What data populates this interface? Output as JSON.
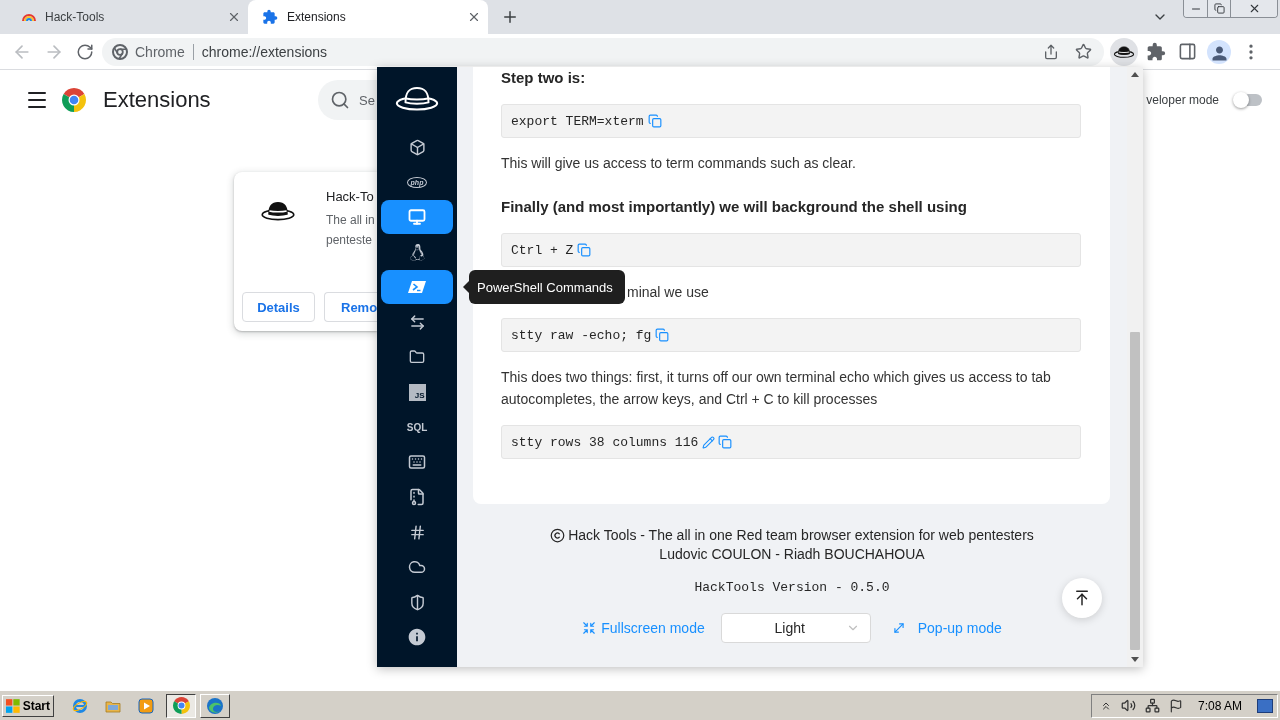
{
  "browser": {
    "tabs": [
      {
        "title": "Hack-Tools",
        "selected": false
      },
      {
        "title": "Extensions",
        "selected": true
      }
    ],
    "toolbar": {
      "back": {
        "disabled": true
      },
      "forward": {
        "disabled": true
      },
      "site_label": "Chrome",
      "url": "chrome://extensions",
      "extension_button": {
        "active": true
      }
    }
  },
  "extensions_page": {
    "title": "Extensions",
    "search": {
      "placeholder": "Se"
    },
    "developer_mode": {
      "label": "veloper mode",
      "on": false
    },
    "card": {
      "name": "Hack-To",
      "description_lines": [
        "The all in",
        "penteste"
      ],
      "buttons": [
        "Details",
        "Remo"
      ]
    }
  },
  "popup": {
    "sidebar": {
      "items": [
        {
          "selected": false
        },
        {
          "label": "php",
          "selected": false
        },
        {
          "selected": true
        },
        {
          "selected": false
        },
        {
          "selected": true
        },
        {
          "selected": false
        },
        {
          "selected": false
        },
        {
          "label": "JS",
          "selected": false
        },
        {
          "label": "SQL",
          "selected": false
        },
        {
          "selected": false
        },
        {
          "selected": false
        },
        {
          "selected": false
        },
        {
          "selected": false
        },
        {
          "selected": false
        },
        {
          "selected": false
        }
      ]
    },
    "tooltip": "PowerShell Commands",
    "content": [
      {
        "kind": "heading",
        "text": "Step two is:"
      },
      {
        "kind": "code",
        "text": "export TERM=xterm",
        "editable": false
      },
      {
        "kind": "paragraph",
        "text": "This will give us access to term commands such as clear."
      },
      {
        "kind": "heading",
        "text": "Finally (and most importantly) we will background the shell using"
      },
      {
        "kind": "code",
        "text": "Ctrl + Z",
        "editable": false
      },
      {
        "kind": "fragment",
        "text": "minal we use"
      },
      {
        "kind": "code",
        "text": "stty raw -echo; fg",
        "editable": false
      },
      {
        "kind": "paragraph",
        "text": "This does two things: first, it turns off our own terminal echo which gives us access to tab autocompletes, the arrow keys, and Ctrl + C to kill processes"
      },
      {
        "kind": "code",
        "text": "stty rows 38 columns 116",
        "editable": true
      }
    ],
    "footer": {
      "credit": "Hack Tools - The all in one Red team browser extension for web pentesters",
      "authors": "Ludovic COULON - Riadh BOUCHAHOUA",
      "version": "HackTools Version - 0.5.0",
      "fullscreen_link": "Fullscreen mode",
      "theme_select": {
        "value": "Light"
      },
      "popup_link": "Pop-up mode"
    }
  },
  "taskbar": {
    "start": "Start",
    "windows": [
      {
        "selected": true
      },
      {
        "selected": false
      }
    ],
    "clock": "7:08 AM"
  }
}
